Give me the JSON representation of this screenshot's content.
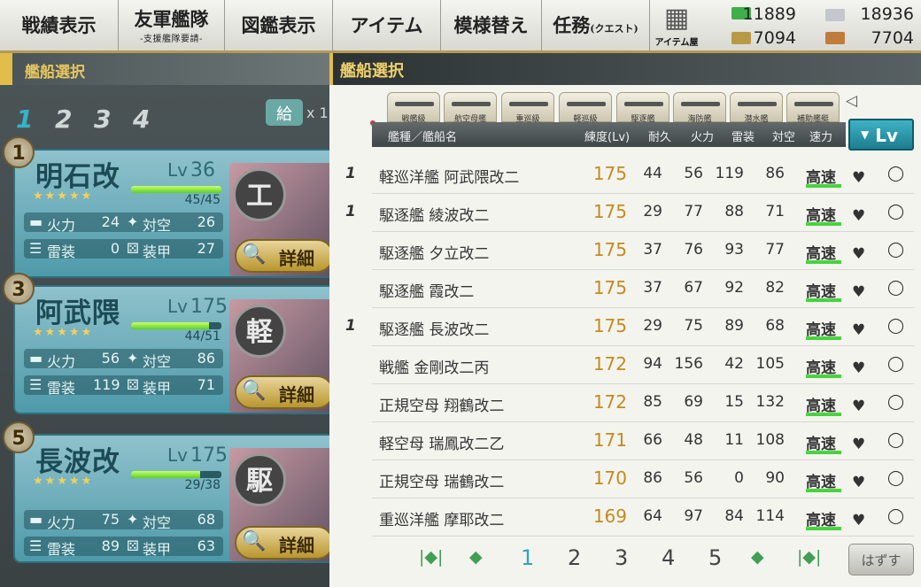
{
  "topnav": {
    "items": [
      {
        "label": "戦績表示",
        "sub": ""
      },
      {
        "label": "友軍艦隊",
        "sub": "-支援艦隊要請-"
      },
      {
        "label": "図鑑表示",
        "sub": ""
      },
      {
        "label": "アイテム",
        "sub": ""
      },
      {
        "label": "模様替え",
        "sub": ""
      },
      {
        "label": "任務",
        "sub": "(クエスト)"
      }
    ],
    "item_shop_label": "アイテム屋",
    "resources": {
      "fuel": "11889",
      "steel": "18936",
      "ammo": "7094",
      "bauxite": "7704"
    }
  },
  "left": {
    "header": "艦船選択",
    "fleet_tabs": [
      "1",
      "2",
      "3",
      "4"
    ],
    "supply_label": "給",
    "supply_count": "x 1",
    "stat_labels": {
      "firepower": "火力",
      "aa": "対空",
      "torpedo": "雷装",
      "armor": "装甲"
    },
    "detail_label": "詳細",
    "ships": [
      {
        "slot": "1",
        "name": "明石改",
        "lv_label": "Lv",
        "level": "36",
        "hp": "45/45",
        "hp_ratio": 1.0,
        "stars": "★★★★★",
        "type_badge": "工",
        "firepower": "24",
        "aa": "26",
        "torpedo": "0",
        "armor": "27"
      },
      {
        "slot": "3",
        "name": "阿武隈",
        "lv_label": "Lv",
        "level": "175",
        "hp": "44/51",
        "hp_ratio": 0.86,
        "stars": "★★★★★",
        "type_badge": "軽",
        "firepower": "56",
        "aa": "86",
        "torpedo": "119",
        "armor": "71"
      },
      {
        "slot": "5",
        "name": "長波改",
        "lv_label": "Lv",
        "level": "175",
        "hp": "29/38",
        "hp_ratio": 0.76,
        "stars": "★★★★★",
        "type_badge": "駆",
        "firepower": "75",
        "aa": "68",
        "torpedo": "89",
        "armor": "63"
      }
    ]
  },
  "right": {
    "header": "艦船選択",
    "type_tabs": [
      "戦艦級",
      "航空母艦",
      "重巡級",
      "軽巡級",
      "駆逐艦",
      "海防艦",
      "潜水艦",
      "補助艦艇"
    ],
    "columns": {
      "name": "艦種／艦船名",
      "level": "練度(Lv)",
      "hp": "耐久",
      "fire": "火力",
      "torp": "雷装",
      "aa": "対空",
      "speed": "速力"
    },
    "sort_label": "Lv",
    "rows": [
      {
        "fleet": "1",
        "name": "軽巡洋艦 阿武隈改二",
        "level": "175",
        "hp": "44",
        "fire": "56",
        "torp": "119",
        "aa": "86",
        "speed": "高速"
      },
      {
        "fleet": "1",
        "name": "駆逐艦 綾波改二",
        "level": "175",
        "hp": "29",
        "fire": "77",
        "torp": "88",
        "aa": "71",
        "speed": "高速"
      },
      {
        "fleet": "",
        "name": "駆逐艦 夕立改二",
        "level": "175",
        "hp": "37",
        "fire": "76",
        "torp": "93",
        "aa": "77",
        "speed": "高速"
      },
      {
        "fleet": "",
        "name": "駆逐艦 霞改二",
        "level": "175",
        "hp": "37",
        "fire": "67",
        "torp": "92",
        "aa": "82",
        "speed": "高速"
      },
      {
        "fleet": "1",
        "name": "駆逐艦 長波改二",
        "level": "175",
        "hp": "29",
        "fire": "75",
        "torp": "89",
        "aa": "68",
        "speed": "高速"
      },
      {
        "fleet": "",
        "name": "戦艦 金剛改二丙",
        "level": "172",
        "hp": "94",
        "fire": "156",
        "torp": "42",
        "aa": "105",
        "speed": "高速"
      },
      {
        "fleet": "",
        "name": "正規空母 翔鶴改二",
        "level": "172",
        "hp": "85",
        "fire": "69",
        "torp": "15",
        "aa": "132",
        "speed": "高速"
      },
      {
        "fleet": "",
        "name": "軽空母 瑞鳳改二乙",
        "level": "171",
        "hp": "66",
        "fire": "48",
        "torp": "11",
        "aa": "108",
        "speed": "高速"
      },
      {
        "fleet": "",
        "name": "正規空母 瑞鶴改二",
        "level": "170",
        "hp": "86",
        "fire": "56",
        "torp": "0",
        "aa": "90",
        "speed": "高速"
      },
      {
        "fleet": "",
        "name": "重巡洋艦 摩耶改二",
        "level": "169",
        "hp": "64",
        "fire": "97",
        "torp": "84",
        "aa": "114",
        "speed": "高速"
      }
    ],
    "pager": {
      "pages": [
        "1",
        "2",
        "3",
        "4",
        "5"
      ],
      "current": "1"
    },
    "unset_label": "はずす"
  },
  "colors": {
    "accent": "#e2bd4a",
    "teal": "#2fa5bd",
    "level_text": "#c48a1e",
    "speed_bar": "#44d43b"
  }
}
